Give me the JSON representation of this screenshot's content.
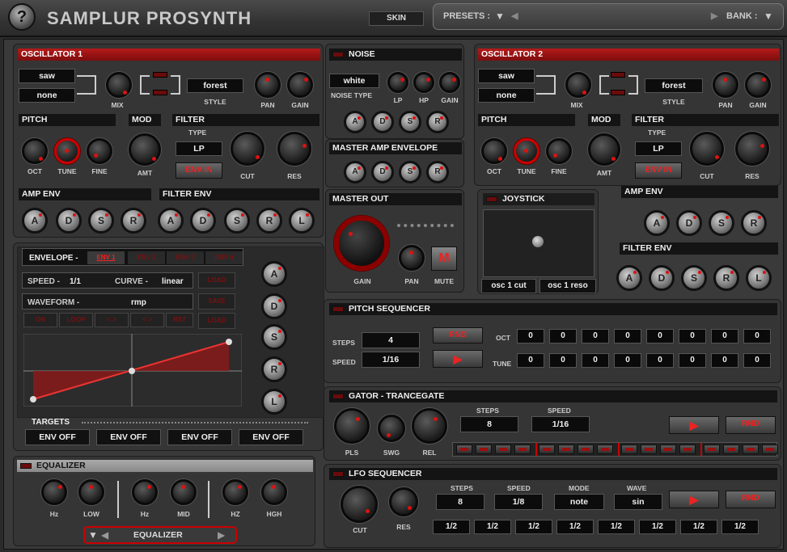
{
  "app": {
    "title": "SAMPLUR PROSYNTH",
    "help": "?",
    "skin": "SKIN",
    "presets": "PRESETS :",
    "bank": "BANK :"
  },
  "osc1": {
    "title": "OSCILLATOR 1",
    "wave1": "saw",
    "wave2": "none",
    "mix": "MIX",
    "style_value": "forest",
    "style": "STYLE",
    "pan": "PAN",
    "gain": "GAIN",
    "pitch": "PITCH",
    "mod": "MOD",
    "filter": "FILTER",
    "type": "TYPE",
    "filter_type": "LP",
    "env_in": "ENV IN",
    "oct": "OCT",
    "tune": "TUNE",
    "fine": "FINE",
    "amt": "AMT",
    "cut": "CUT",
    "res": "RES",
    "amp_env": "AMP ENV",
    "filter_env": "FILTER ENV"
  },
  "osc2": {
    "title": "OSCILLATOR 2",
    "wave1": "saw",
    "wave2": "none",
    "mix": "MIX",
    "style_value": "forest",
    "style": "STYLE",
    "pan": "PAN",
    "gain": "GAIN",
    "pitch": "PITCH",
    "mod": "MOD",
    "filter": "FILTER",
    "type": "TYPE",
    "filter_type": "LP",
    "env_in": "ENV IN",
    "oct": "OCT",
    "tune": "TUNE",
    "fine": "FINE",
    "amt": "AMT",
    "cut": "CUT",
    "res": "RES",
    "amp_env": "AMP ENV",
    "filter_env": "FILTER ENV"
  },
  "adsr": {
    "a": "A",
    "d": "D",
    "s": "S",
    "r": "R",
    "l": "L"
  },
  "noise": {
    "title": "NOISE",
    "type_value": "white",
    "type": "NOISE TYPE",
    "lp": "LP",
    "hp": "HP",
    "gain": "GAIN"
  },
  "master_amp": {
    "title": "MASTER AMP ENVELOPE"
  },
  "master_out": {
    "title": "MASTER OUT",
    "gain": "GAIN",
    "pan": "PAN",
    "mute": "MUTE",
    "mute_btn": "M"
  },
  "joystick": {
    "title": "JOYSTICK",
    "x_target": "osc 1 cut",
    "y_target": "osc 1 reso"
  },
  "envelope": {
    "title": "ENVELOPE -",
    "tabs": [
      "ENV 1",
      "ENV 2",
      "ENV 3",
      "ENV 4"
    ],
    "speed": "SPEED -",
    "speed_value": "1/1",
    "curve": "CURVE -",
    "curve_value": "linear",
    "waveform": "WAVEFORM -",
    "waveform_value": "rmp",
    "side_btns": [
      "LOAD",
      "SAVE",
      "LOAD"
    ],
    "row_btns": [
      "ON",
      "LOOP",
      "< >",
      "< >",
      "RST"
    ],
    "targets": "TARGETS",
    "target_values": [
      "ENV OFF",
      "ENV OFF",
      "ENV OFF",
      "ENV OFF"
    ]
  },
  "equalizer": {
    "title": "EQUALIZER",
    "hz1": "Hz",
    "low": "LOW",
    "hz2": "Hz",
    "mid": "MID",
    "hz3": "HZ",
    "high": "HGH",
    "selector": "EQUALIZER"
  },
  "pitch_seq": {
    "title": "PITCH SEQUENCER",
    "steps_label": "STEPS",
    "steps": "4",
    "speed_label": "SPEED",
    "speed": "1/16",
    "rnd": "RND",
    "oct": "OCT",
    "tune": "TUNE",
    "oct_values": [
      "0",
      "0",
      "0",
      "0",
      "0",
      "0",
      "0",
      "0"
    ],
    "tune_values": [
      "0",
      "0",
      "0",
      "0",
      "0",
      "0",
      "0",
      "0"
    ]
  },
  "gator": {
    "title": "GATOR - TRANCEGATE",
    "pls": "PLS",
    "swg": "SWG",
    "rel": "REL",
    "steps_label": "STEPS",
    "steps": "8",
    "speed_label": "SPEED",
    "speed": "1/16",
    "rnd": "RND"
  },
  "lfo_seq": {
    "title": "LFO SEQUENCER",
    "cut": "CUT",
    "res": "RES",
    "steps_label": "STEPS",
    "steps": "8",
    "speed_label": "SPEED",
    "speed": "1/8",
    "mode_label": "MODE",
    "mode": "note",
    "wave_label": "WAVE",
    "wave": "sin",
    "rnd": "RND",
    "values": [
      "1/2",
      "1/2",
      "1/2",
      "1/2",
      "1/2",
      "1/2",
      "1/2",
      "1/2"
    ]
  },
  "colors": {
    "accent_red": "#b51a1a",
    "led_red": "#d11111",
    "panel": "#353535",
    "background": "#2b2b2b"
  }
}
